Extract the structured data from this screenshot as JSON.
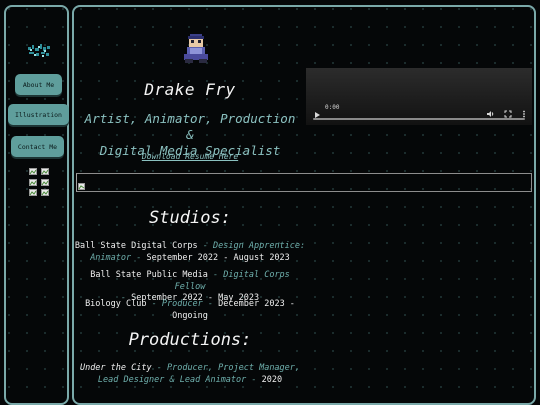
{
  "nav": {
    "logo_name": "logo-icon",
    "items": [
      {
        "label": "About Me"
      },
      {
        "label": "Illustration"
      },
      {
        "label": "Contact Me"
      }
    ],
    "social_icons": [
      "broken-image-icon",
      "broken-image-icon",
      "broken-image-icon",
      "broken-image-icon",
      "broken-image-icon",
      "broken-image-icon"
    ]
  },
  "profile": {
    "name": "Drake Fry",
    "subtitle_line1": "Artist, Animator, Production &",
    "subtitle_line2": "Digital Media Specialist",
    "resume_link": "Download Resume Here"
  },
  "video": {
    "time": "0:00"
  },
  "studios": {
    "heading": "Studios:",
    "entries": [
      {
        "org": "Ball State Digital Corps",
        "sep1": " - ",
        "role_l1": "Design Apprentice:",
        "role_l2": "Animator",
        "sep2": " - ",
        "dates": "September 2022 - August 2023"
      },
      {
        "org": "Ball State Public Media",
        "sep1": " - ",
        "role": "Digital Corps Fellow",
        "sep2": " - ",
        "dates": "September 2022 - May 2023"
      },
      {
        "org": "Biology Club",
        "sep1": " - ",
        "role": "Producer",
        "sep2": " - ",
        "dates_l1": "December 2023 -",
        "dates_l2": "Ongoing"
      }
    ]
  },
  "productions": {
    "heading": "Productions:",
    "entries": [
      {
        "title": "Under the City",
        "sep1": " - ",
        "role_l1": "Producer, Project Manager,",
        "role_l2": "Lead Designer & Lead Animator",
        "sep2": " - ",
        "year": "2020"
      }
    ]
  },
  "colors": {
    "accent": "#6fb0ad",
    "button": "#5f9e9c",
    "border": "#7aa9a9",
    "background": "#050708"
  }
}
